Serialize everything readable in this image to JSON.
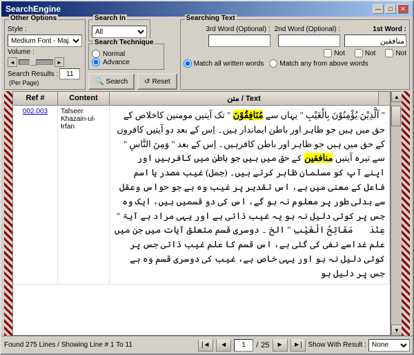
{
  "window": {
    "title": "SearchEngine",
    "min_btn": "—",
    "max_btn": "□",
    "close_btn": "✕"
  },
  "other_options": {
    "label": "Other Options",
    "style_label": "Style :",
    "style_value": "Medium Font - Maj...",
    "volume_label": "Volume :",
    "search_results_label": "Search Results :",
    "per_page_label": "(Per Page)",
    "results_value": "11"
  },
  "search_in": {
    "label": "Search In",
    "value": "All"
  },
  "search_technique": {
    "label": "Search Technique",
    "normal_label": "Normal",
    "advance_label": "Advance",
    "selected": "Advance"
  },
  "buttons": {
    "search_label": "Search",
    "reset_label": "Reset"
  },
  "searching_text": {
    "label": "Searching Text",
    "word3_label": "3rd Word (Optional) :",
    "word2_label": "2nd Word (Optional) :",
    "word1_label": "1st Word :",
    "word1_value": "منافقین",
    "not1_label": "Not",
    "not2_label": "Not",
    "not3_label": "Not",
    "match_all_label": "Match all written words",
    "match_any_label": "Match any from above words"
  },
  "table": {
    "header": {
      "ref": "Ref #",
      "content": "Content",
      "text": "متن / Text"
    },
    "rows": [
      {
        "ref": "002.003",
        "content": "Tafseer Khazain-ul-Irfan",
        "text": "\" آلَّذِیْنَ یُؤْمِنُوْنَ بِالْغَیْبِ \" یہاں سے مُنَافِقُوْنَ \" تک آیتیں مومنین کاخلاص کے حق میں ہیں جو ظاہر اور باطن ایماندار ہیں۔ اِس کے بعد دو آیتیں کافروں کے حق میں ہیں جو ظاہر اور باطن کافرہیں۔ اِس کے بعد \" وَمِنَ النَّاسِ \" سے تیرہ آیتیں منافقین کے حق میں ہیں جو باطن میں کافرہیں اور اپنے آپ کو مسلمان ظاہر کرتے ہیں۔ (جمل) غیب مصدر یا اسم فاعل کے معنی میں ہے، اس تقدیر پر غیب وہ ہے جو حواس وعقل سے بدلی طور پر معلوم نہ ہو گے، اس کی دو قسمیں ہیں، ایک وہ جس پر کوئی دلیل نہ ہو یہ غیب ذاتی ہے اور یہی مراد ہے آیۃ \" عِنْدَہٗ مَفَاتِحُ الْغَیْبِ \" الخ ۔ دوسری قسم متعلق آیات میں جن میں علم غداسے نفی کی گئی ہے، اس قسم کا علم غیب ذاتی جس پر کوئی دلیل نہ ہو اور یہی خاص ہے، غیب کی دوسری قسم وہ ہے جس پر دلیل ہو"
      }
    ]
  },
  "status_bar": {
    "found_text": "Found 275 Lines / Showing Line # 1 To 11",
    "page_current": "1",
    "page_total": "25",
    "show_result_label": "Show With Result :",
    "show_result_value": "None"
  }
}
